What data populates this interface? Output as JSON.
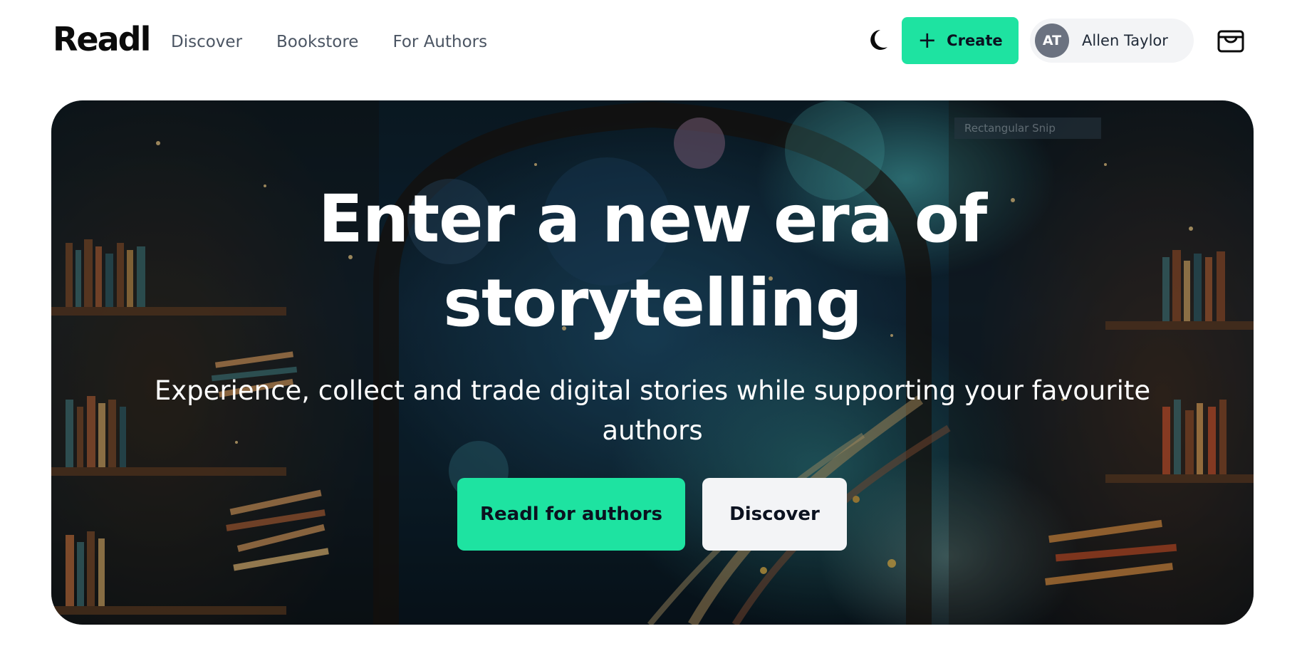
{
  "brand": {
    "name": "Readl"
  },
  "nav": {
    "links": [
      "Discover",
      "Bookstore",
      "For Authors"
    ]
  },
  "header": {
    "create_label": "Create",
    "user": {
      "initials": "AT",
      "name": "Allen Taylor"
    }
  },
  "hero": {
    "overlay_text": "Rectangular Snip",
    "title": "Enter a new era of storytelling",
    "subtitle": "Experience, collect and trade digital stories while supporting your favourite authors",
    "primary_button": "Readl for authors",
    "secondary_button": "Discover"
  },
  "colors": {
    "accent": "#1ee3a1",
    "secondary_button_bg": "#f3f4f6",
    "avatar_bg": "#6b7280"
  },
  "icons": {
    "theme_toggle": "moon-icon",
    "create": "plus-icon",
    "wallet": "wallet-icon"
  }
}
